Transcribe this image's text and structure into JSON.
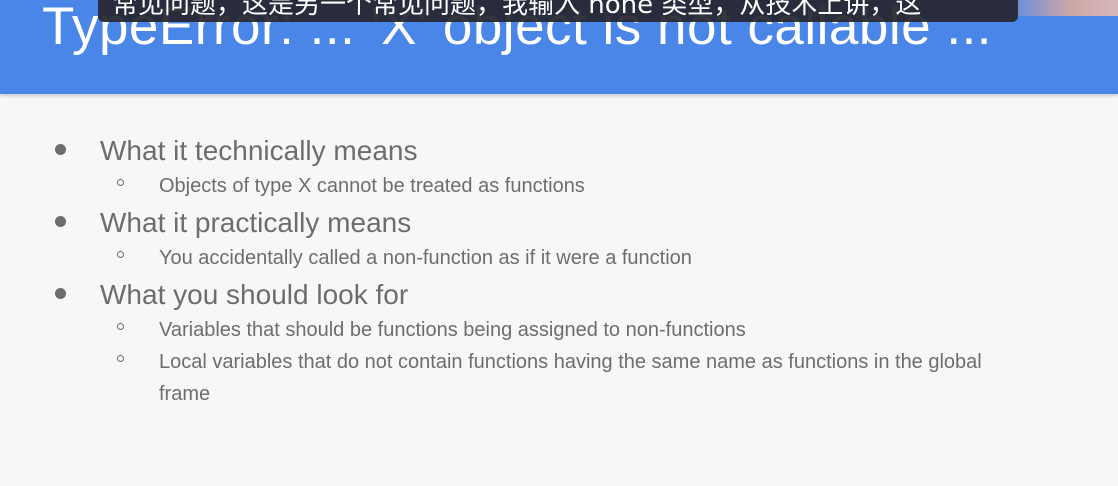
{
  "slide": {
    "title": "TypeError: ... 'X' object is not callable ...",
    "subtitle_caption": "常见问题，这是另一个常见问题，我输入 none 类型，从技术上讲，这",
    "bullets": [
      {
        "label": "What it technically means",
        "sub": [
          "Objects of type X cannot be treated as functions"
        ]
      },
      {
        "label": "What it practically means",
        "sub": [
          "You accidentally called a non-function as if it were a function"
        ]
      },
      {
        "label": "What you should look for",
        "sub": [
          "Variables that should be functions being assigned to non-functions",
          "Local variables that do not contain functions having the same name as functions in the global frame"
        ]
      }
    ]
  },
  "colors": {
    "header_bg": "#4a86e8",
    "title_text": "#ffffff",
    "body_text": "#6d6d6d",
    "slide_bg": "#f7f7f7",
    "caption_bg": "#26262e"
  }
}
